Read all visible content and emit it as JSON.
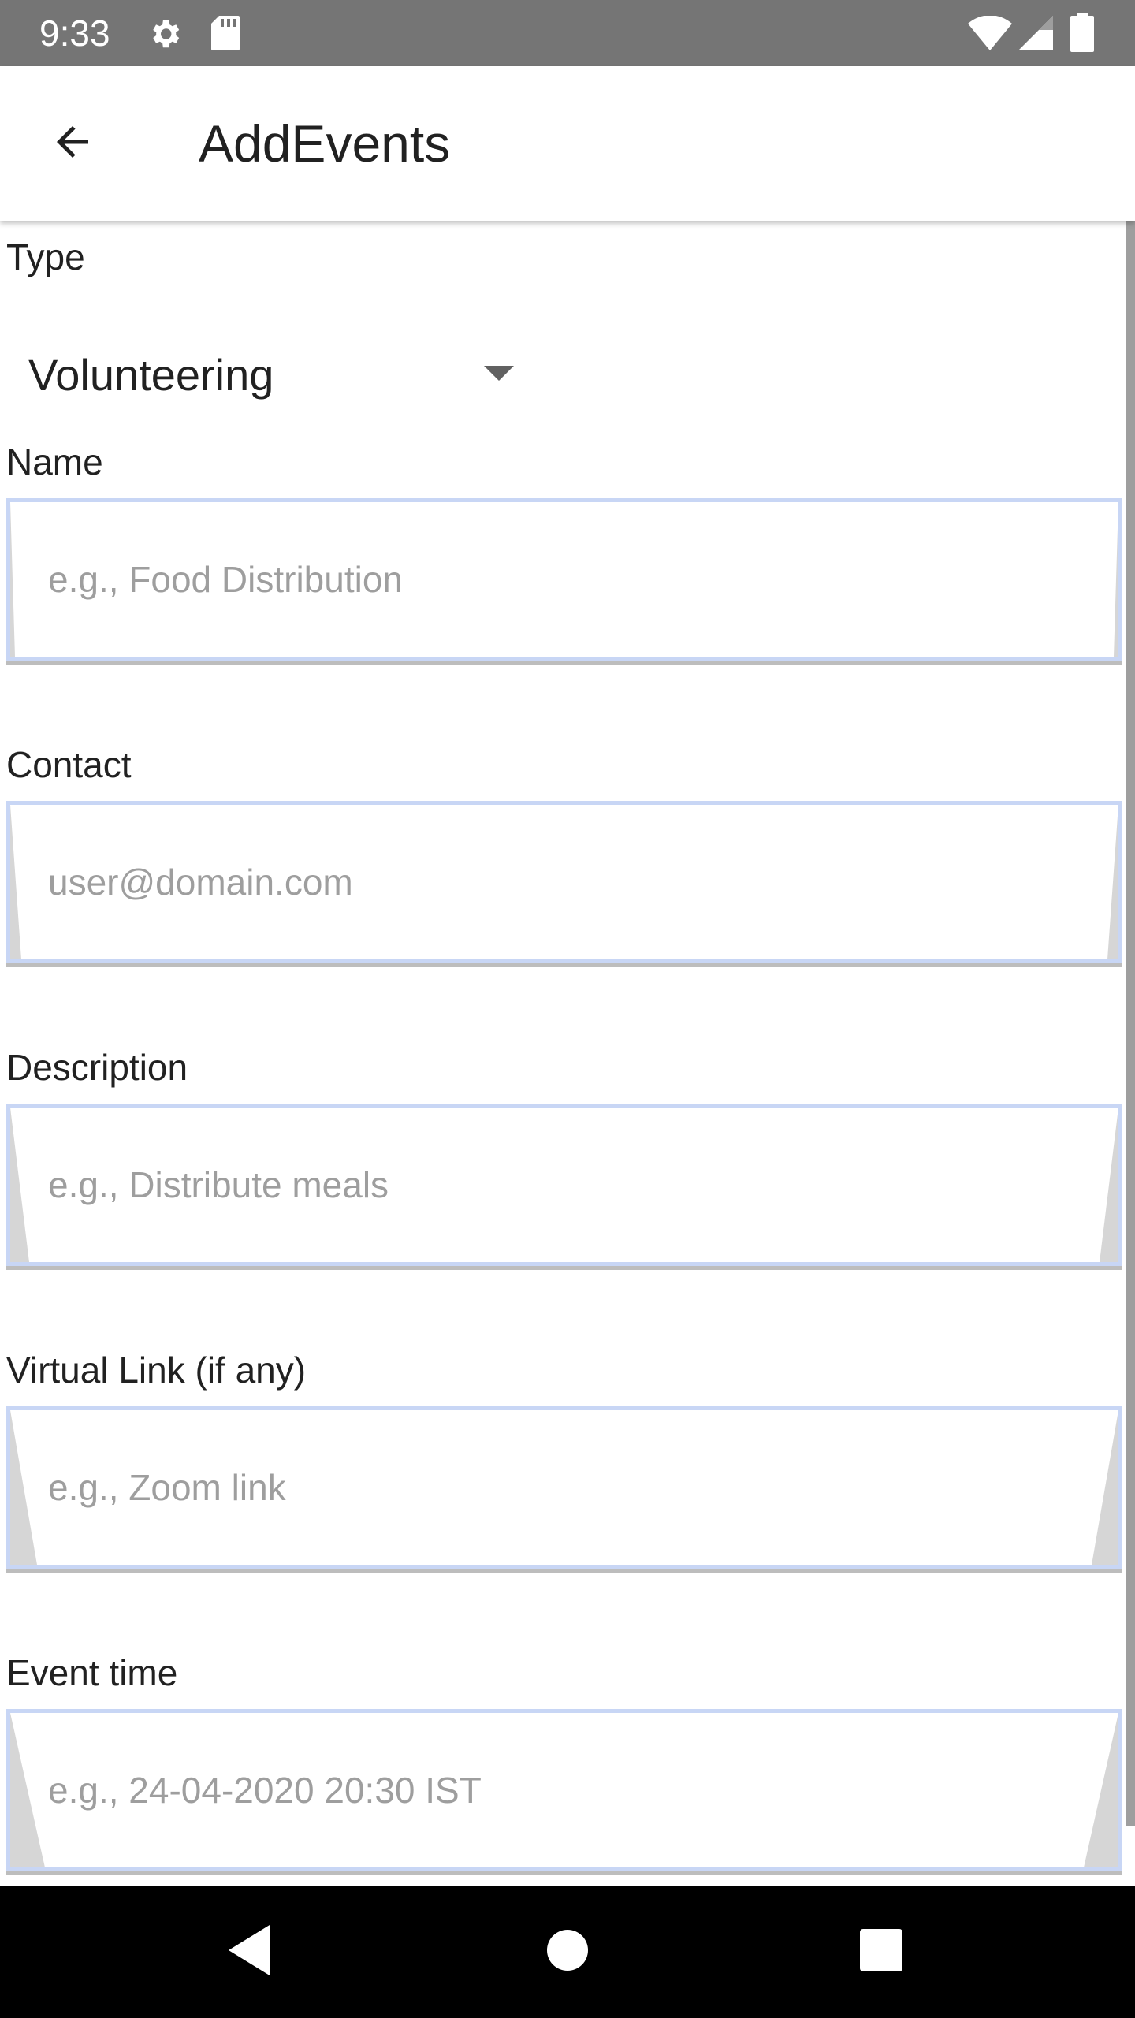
{
  "status_bar": {
    "time": "9:33",
    "icons": [
      "gear-icon",
      "sd-card-icon",
      "wifi-icon",
      "signal-icon",
      "battery-icon"
    ]
  },
  "app_bar": {
    "title": "AddEvents",
    "back_icon": "arrow-left-icon"
  },
  "form": {
    "type": {
      "label": "Type",
      "selected": "Volunteering"
    },
    "name": {
      "label": "Name",
      "value": "",
      "placeholder": "e.g., Food Distribution"
    },
    "contact": {
      "label": "Contact",
      "value": "",
      "placeholder": "user@domain.com"
    },
    "description": {
      "label": "Description",
      "value": "",
      "placeholder": "e.g., Distribute meals"
    },
    "virtual_link": {
      "label": "Virtual Link (if any)",
      "value": "",
      "placeholder": "e.g., Zoom link"
    },
    "event_time": {
      "label": "Event time",
      "value": "",
      "placeholder": "e.g., 24-04-2020 20:30 IST"
    }
  },
  "nav_bar": {
    "icons": [
      "back-triangle-icon",
      "home-circle-icon",
      "recents-square-icon"
    ]
  },
  "colors": {
    "status_bar": "#757575",
    "input_border": "#c8d6f5",
    "placeholder": "#9e9e9e",
    "text": "#212121",
    "nav_bar": "#000000"
  }
}
